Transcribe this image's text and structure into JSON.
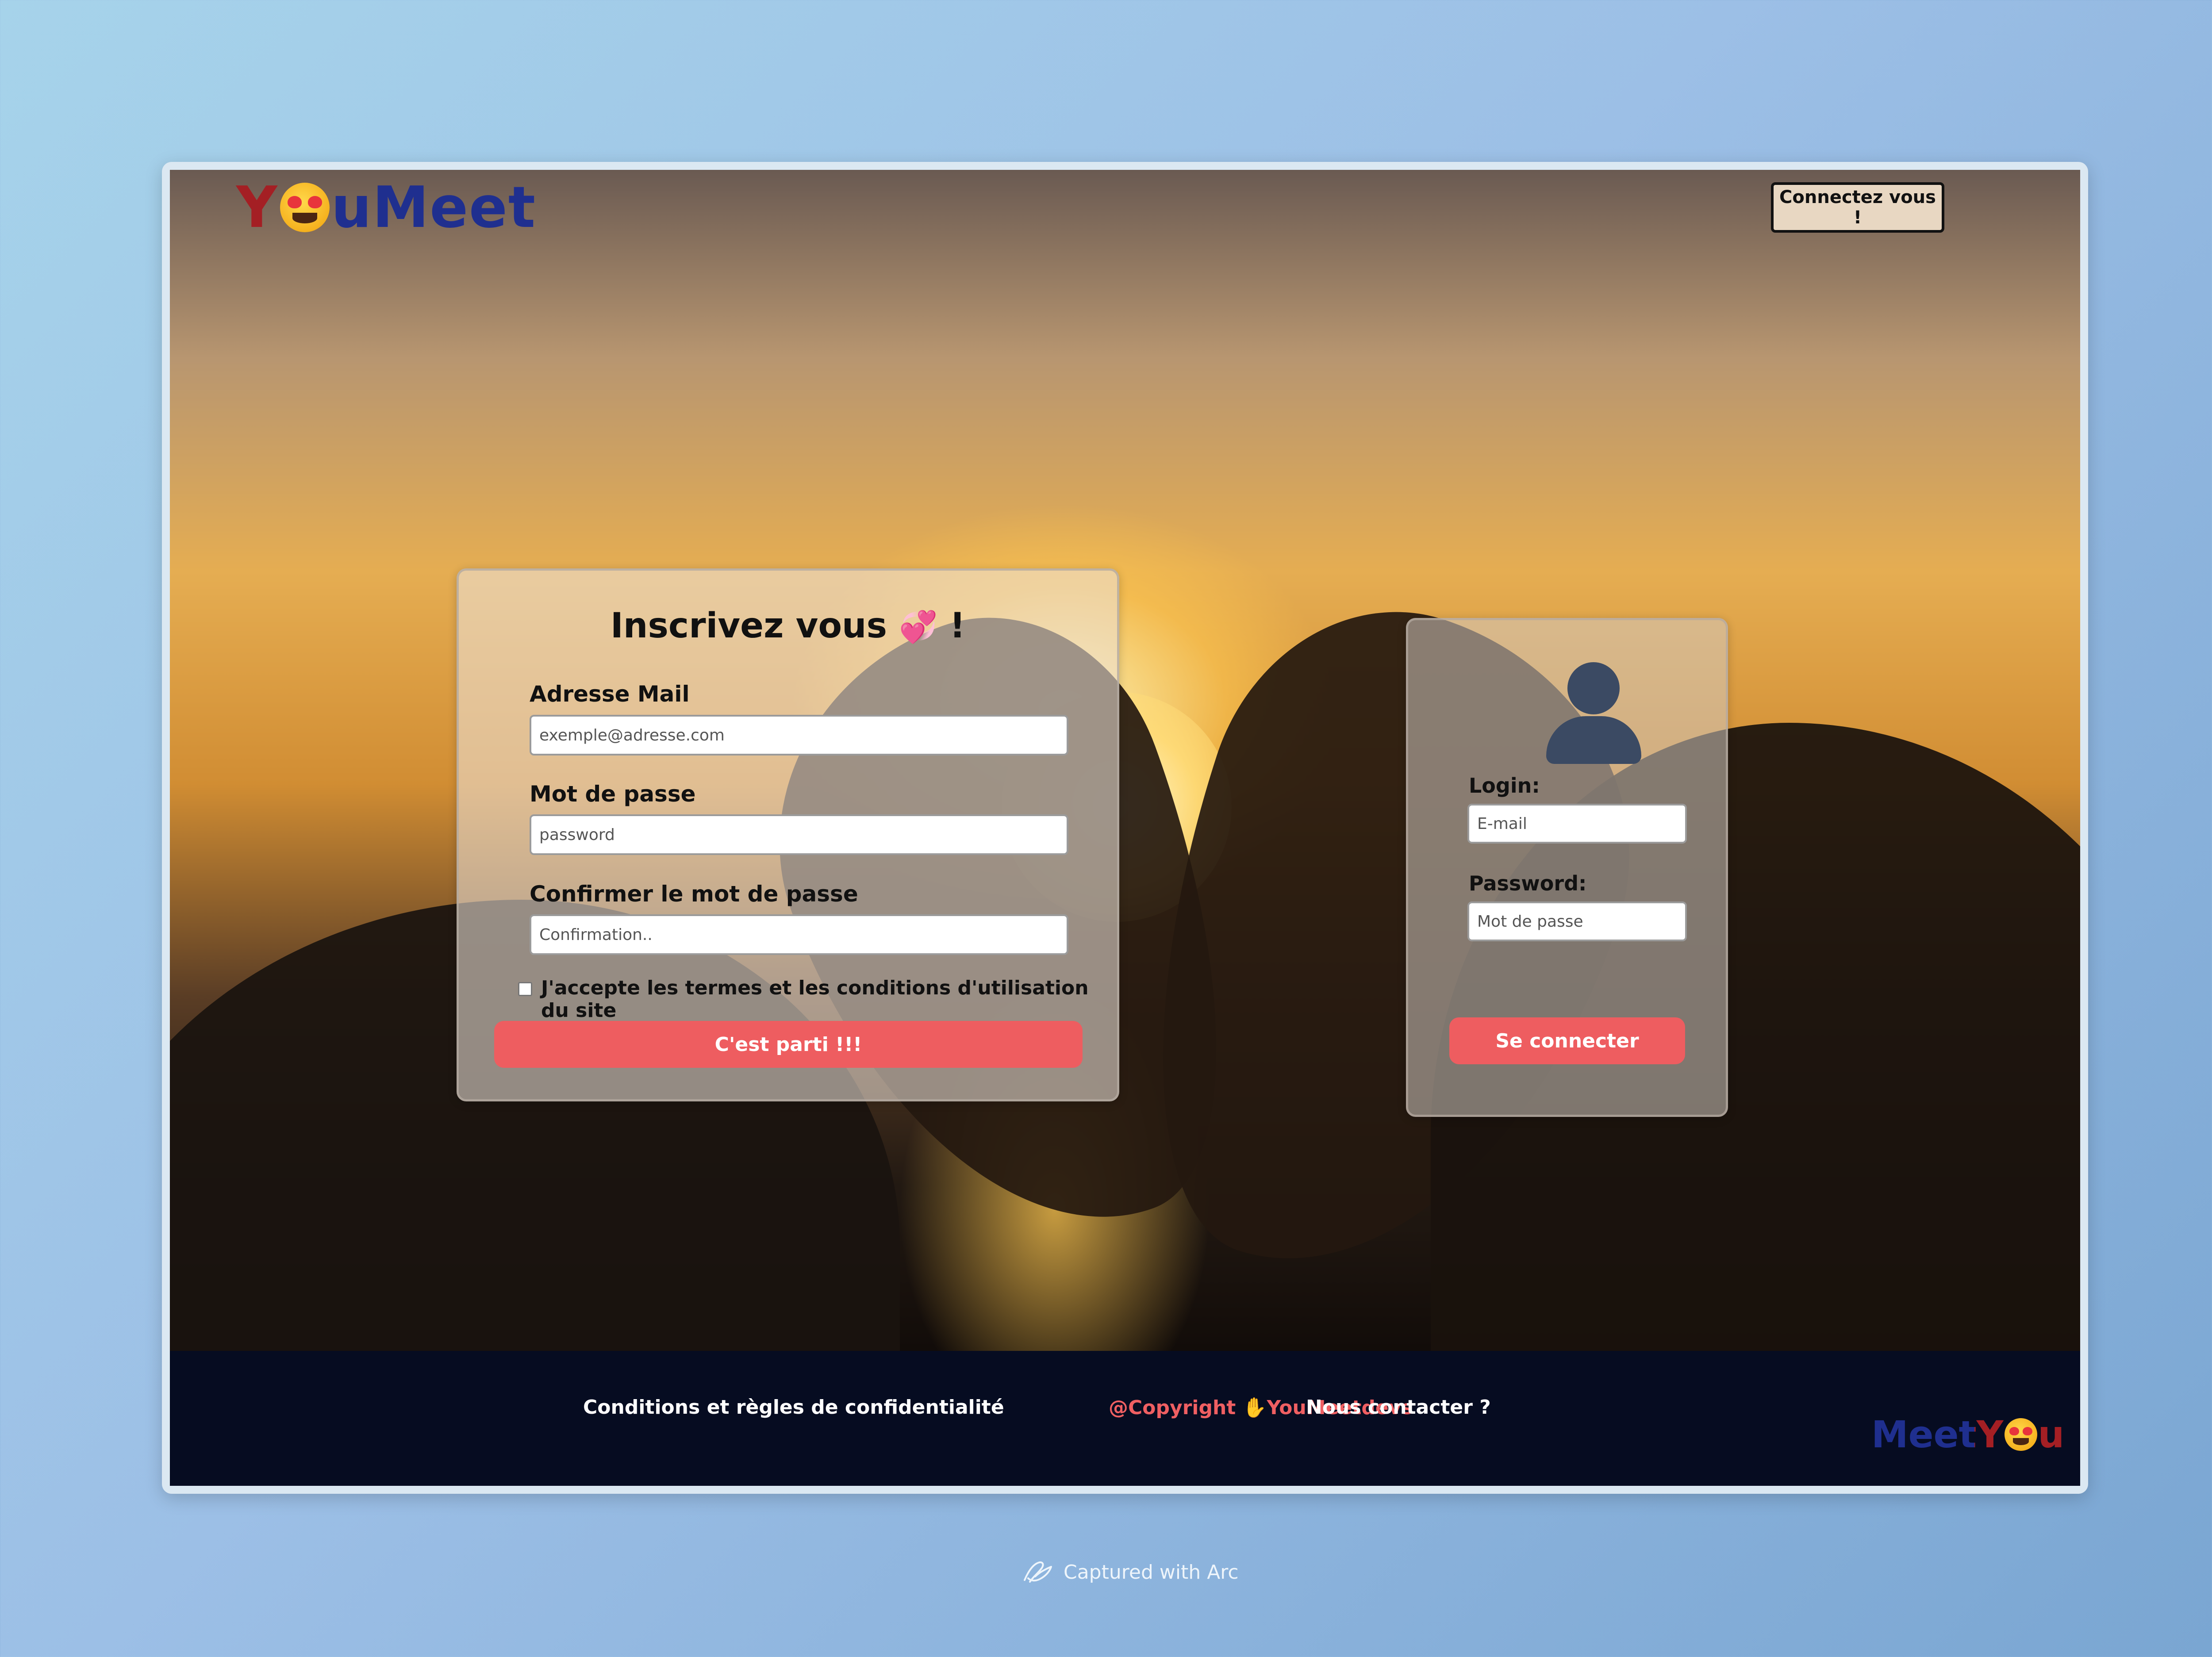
{
  "brand": {
    "logo_start": "Y",
    "logo_end": "uMeet",
    "footer_logo_start": "MeetY",
    "footer_logo_end": "u",
    "logo_emoji_icon": "heart-eyes-emoji-icon",
    "colors": {
      "logo_red": "#a41f24",
      "logo_blue": "#1f2f8f",
      "accent": "#ee5d60",
      "footer_bg": "#060c21"
    }
  },
  "header": {
    "connect_button": "Connectez vous !"
  },
  "signup": {
    "title": "Inscrivez vous",
    "title_suffix": "!",
    "title_icon": "two-hearts-emoji-icon",
    "email_label": "Adresse Mail",
    "email_placeholder": "exemple@adresse.com",
    "password_label": "Mot de passe",
    "password_placeholder": "password",
    "confirm_label": "Confirmer le mot de passe",
    "confirm_placeholder": "Confirmation..",
    "terms_label": "J'accepte les termes et les conditions d'utilisation du site",
    "submit_button": "C'est parti !!!"
  },
  "login": {
    "avatar_icon": "user-silhouette-icon",
    "login_label": "Login:",
    "login_placeholder": "E-mail",
    "password_label": "Password:",
    "password_placeholder": "Mot de passe",
    "submit_button": "Se connecter"
  },
  "footer": {
    "privacy_link": "Conditions et règles de confidentialité",
    "copyright_prefix": "@Copyright",
    "copyright_icon": "waving-hand-emoji-icon",
    "copyright_name": "YouMeetdevs",
    "contact_link": "Nous contacter ?"
  },
  "capture": {
    "text": "Captured with Arc",
    "icon": "arc-browser-icon"
  }
}
